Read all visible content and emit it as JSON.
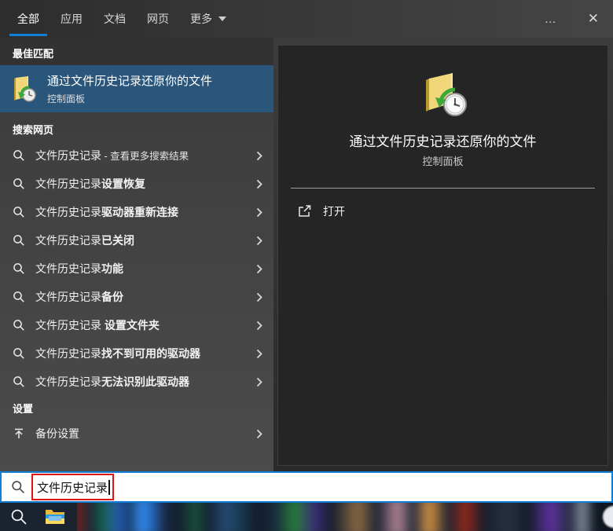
{
  "colors": {
    "accent": "#0f7fd7",
    "best_match_highlight": "#2a567c",
    "annotation_red": "#dd1414"
  },
  "tabs": {
    "items": [
      {
        "label": "全部",
        "selected": true
      },
      {
        "label": "应用",
        "selected": false
      },
      {
        "label": "文档",
        "selected": false
      },
      {
        "label": "网页",
        "selected": false
      },
      {
        "label": "更多",
        "selected": false,
        "has_dropdown": true
      }
    ]
  },
  "topbar": {
    "more_options": "…",
    "close": "✕"
  },
  "best_match": {
    "header": "最佳匹配",
    "item": {
      "title": "通过文件历史记录还原你的文件",
      "subtitle": "控制面板",
      "icon": "file-history-folder-icon"
    }
  },
  "search_web": {
    "header": "搜索网页",
    "items": [
      {
        "query": "文件历史记录",
        "suffix": " - 查看更多搜索结果"
      },
      {
        "query": "文件历史记录",
        "suffix": "设置恢复"
      },
      {
        "query": "文件历史记录",
        "suffix": "驱动器重新连接"
      },
      {
        "query": "文件历史记录",
        "suffix": "已关闭"
      },
      {
        "query": "文件历史记录",
        "suffix": "功能"
      },
      {
        "query": "文件历史记录",
        "suffix": "备份"
      },
      {
        "query": "文件历史记录",
        "suffix": " 设置文件夹"
      },
      {
        "query": "文件历史记录",
        "suffix": "找不到可用的驱动器"
      },
      {
        "query": "文件历史记录",
        "suffix": "无法识别此驱动器"
      }
    ]
  },
  "settings": {
    "header": "设置",
    "items": [
      {
        "label": "备份设置",
        "icon": "backup-up-arrow-icon"
      }
    ]
  },
  "preview": {
    "title": "通过文件历史记录还原你的文件",
    "subtitle": "控制面板",
    "icon": "file-history-folder-icon",
    "actions": [
      {
        "label": "打开",
        "icon": "open-external-icon"
      }
    ]
  },
  "search_box": {
    "value": "文件历史记录",
    "annotation": "red-highlight-box"
  },
  "taskbar": {
    "icons": [
      "search-icon",
      "file-explorer-icon"
    ],
    "thumbnail_strip": "blurred-app-icons"
  },
  "icons": {
    "search": "magnifier",
    "chevron_right": "›",
    "dropdown": "▼",
    "close": "✕",
    "more": "…"
  }
}
